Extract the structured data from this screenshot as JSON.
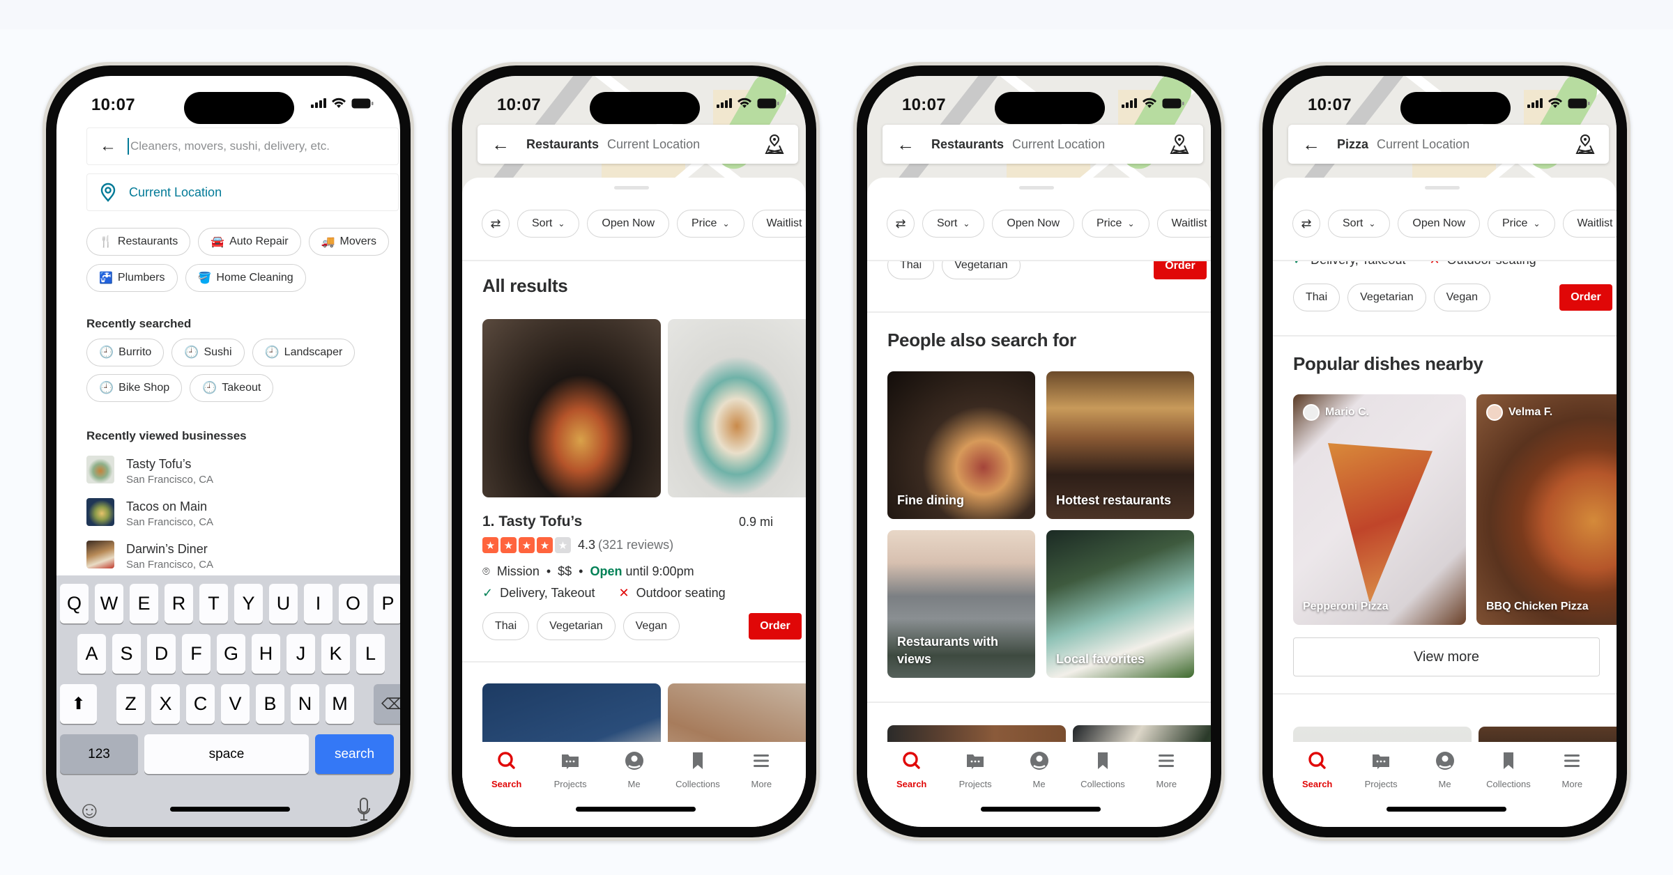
{
  "colors": {
    "accent_red": "#e00707",
    "star_orange": "#ff643d",
    "open_green": "#008055",
    "location_teal": "#027a97",
    "keyboard_blue": "#3478f6"
  },
  "status_bar": {
    "time": "10:07"
  },
  "tab_bar": [
    {
      "icon": "search-icon",
      "label": "Search",
      "active": true
    },
    {
      "icon": "projects-icon",
      "label": "Projects"
    },
    {
      "icon": "me-icon",
      "label": "Me"
    },
    {
      "icon": "collections-icon",
      "label": "Collections"
    },
    {
      "icon": "more-icon",
      "label": "More"
    }
  ],
  "filters": [
    {
      "icon": "filter-sliders-icon",
      "label": ""
    },
    {
      "label": "Sort",
      "dropdown": true
    },
    {
      "label": "Open Now"
    },
    {
      "label": "Price",
      "dropdown": true
    },
    {
      "label": "Waitlist"
    }
  ],
  "screen1": {
    "search_placeholder": "Cleaners, movers, sushi, delivery, etc.",
    "location_value": "Current Location",
    "categories": [
      {
        "icon": "fork-knife-icon",
        "label": "Restaurants"
      },
      {
        "icon": "car-icon",
        "label": "Auto Repair"
      },
      {
        "icon": "truck-icon",
        "label": "Movers"
      },
      {
        "icon": "faucet-icon",
        "label": "Plumbers"
      },
      {
        "icon": "bucket-icon",
        "label": "Home Cleaning"
      }
    ],
    "recently_searched_title": "Recently searched",
    "recently_searched": [
      "Burrito",
      "Sushi",
      "Landscaper",
      "Bike Shop",
      "Takeout"
    ],
    "recently_viewed_title": "Recently viewed businesses",
    "recently_viewed": [
      {
        "name": "Tasty Tofu’s",
        "city": "San Francisco, CA"
      },
      {
        "name": "Tacos on Main",
        "city": "San Francisco, CA"
      },
      {
        "name": "Darwin’s Diner",
        "city": "San Francisco, CA"
      }
    ],
    "keyboard": {
      "row1": [
        "Q",
        "W",
        "E",
        "R",
        "T",
        "Y",
        "U",
        "I",
        "O",
        "P"
      ],
      "row2": [
        "A",
        "S",
        "D",
        "F",
        "G",
        "H",
        "J",
        "K",
        "L"
      ],
      "row3": [
        "Z",
        "X",
        "C",
        "V",
        "B",
        "N",
        "M"
      ],
      "numbers_key": "123",
      "space_key": "space",
      "action_key": "search"
    }
  },
  "screen2": {
    "query": "Restaurants",
    "location": "Current Location",
    "section_title": "All results",
    "result": {
      "title": "1. Tasty Tofu’s",
      "distance": "0.9 mi",
      "rating": 4.3,
      "rating_text": "4.3",
      "reviews": "(321 reviews)",
      "stars_filled": 4,
      "stars_total": 5,
      "neighborhood": "Mission",
      "price": "$$",
      "open_label": "Open",
      "hours": "until 9:00pm",
      "amenity_yes": "Delivery, Takeout",
      "amenity_no": "Outdoor seating",
      "tags": [
        "Thai",
        "Vegetarian",
        "Vegan"
      ],
      "order_label": "Order"
    }
  },
  "screen3": {
    "query": "Restaurants",
    "location": "Current Location",
    "tags": [
      "Thai",
      "Vegetarian"
    ],
    "order_label": "Order",
    "section_title": "People also search for",
    "tiles": [
      "Fine dining",
      "Hottest restaurants",
      "Restaurants with views",
      "Local favorites"
    ]
  },
  "screen4": {
    "query": "Pizza",
    "location": "Current Location",
    "amenity_yes": "Delivery, Takeout",
    "amenity_no": "Outdoor seating",
    "tags": [
      "Thai",
      "Vegetarian",
      "Vegan"
    ],
    "order_label": "Order",
    "section_title": "Popular dishes nearby",
    "dishes": [
      {
        "user": "Mario C.",
        "dish": "Pepperoni Pizza"
      },
      {
        "user": "Velma F.",
        "dish": "BBQ Chicken Pizza"
      }
    ],
    "view_more_label": "View more"
  }
}
